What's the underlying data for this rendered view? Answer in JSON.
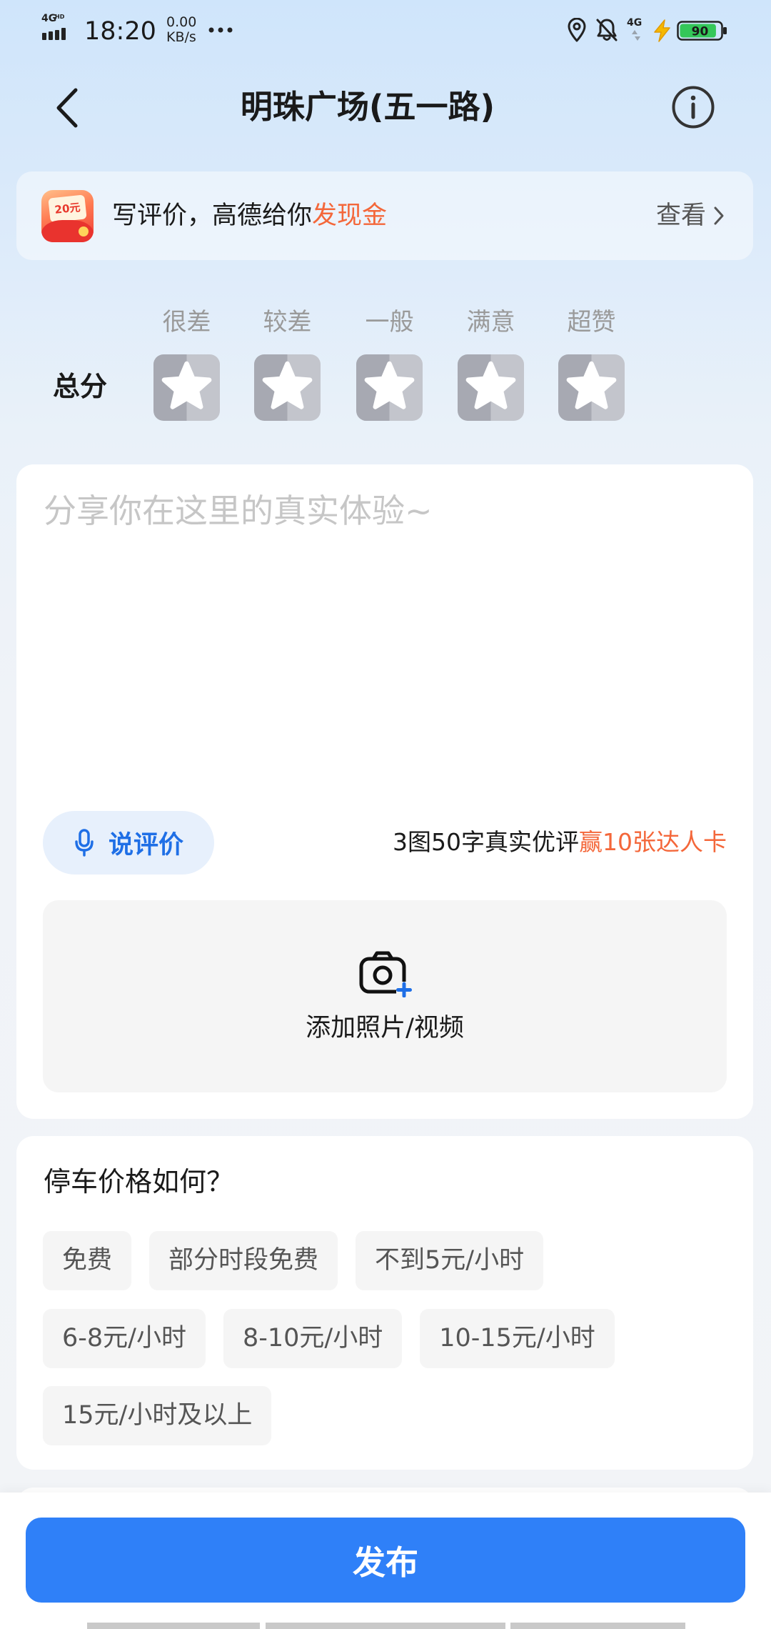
{
  "status": {
    "network": "4G",
    "hd": "HD",
    "time": "18:20",
    "net_speed": "0.00",
    "net_unit": "KB/s",
    "network_right": "4G",
    "battery_level": "90"
  },
  "header": {
    "title": "明珠广场(五一路)"
  },
  "banner": {
    "icon_text": "20元",
    "text": "写评价，高德给你",
    "highlight": "发现金",
    "link": "查看"
  },
  "rating": {
    "label": "总分",
    "options": [
      "很差",
      "较差",
      "一般",
      "满意",
      "超赞"
    ]
  },
  "review": {
    "placeholder": "分享你在这里的真实体验~",
    "voice_button": "说评价",
    "reward_text": "3图50字真实优评",
    "reward_highlight": "赢10张达人卡",
    "add_media": "添加照片/视频"
  },
  "parking": {
    "question": "停车价格如何？",
    "rows": [
      [
        "免费",
        "部分时段免费",
        "不到5元/小时"
      ],
      [
        "6-8元/小时",
        "8-10元/小时",
        "10-15元/小时"
      ],
      [
        "15元/小时及以上"
      ]
    ]
  },
  "footer": {
    "publish": "发布"
  },
  "icons": {
    "back": "chevron-left-icon",
    "info": "info-icon",
    "banner": "cash-envelope-icon",
    "banner_link": "chevron-right-icon",
    "rating": "star-icon",
    "voice": "microphone-icon",
    "media": "camera-add-icon",
    "status": [
      "signal-icon",
      "more-notifications-icon",
      "location-icon",
      "bell-off-icon",
      "mobile-data-icon",
      "charging-icon",
      "battery-icon"
    ]
  },
  "colors": {
    "accent_blue": "#1f6fe6",
    "accent_orange": "#f4673a",
    "publish_button": "#2f80f8",
    "battery_fill": "#34c759"
  }
}
